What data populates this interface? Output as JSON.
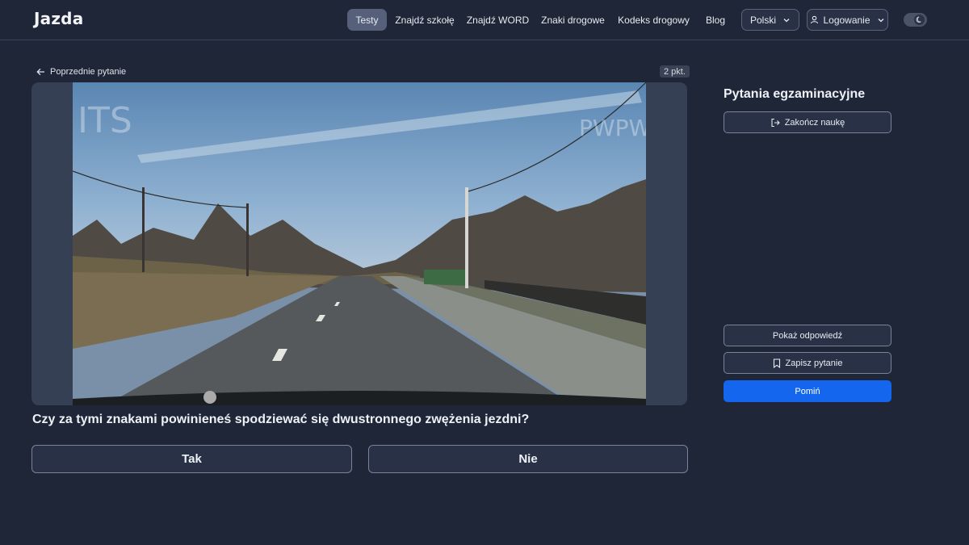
{
  "header": {
    "logo": "Jazda",
    "nav": [
      {
        "label": "Testy"
      },
      {
        "label": "Znajdź szkołę"
      },
      {
        "label": "Znajdź WORD"
      },
      {
        "label": "Znaki drogowe"
      },
      {
        "label": "Kodeks drogowy"
      },
      {
        "label": "Blog"
      }
    ],
    "language": "Polski",
    "login": "Logowanie"
  },
  "question": {
    "back_label": "Poprzednie pytanie",
    "points": "2 pkt.",
    "text": "Czy za tymi znakami powinieneś spodziewać się dwustronnego zwężenia jezdni?",
    "answers": [
      "Tak",
      "Nie"
    ],
    "video": {
      "watermark_left": "ITS",
      "watermark_right": "PWPW"
    }
  },
  "sidebar": {
    "title": "Pytania egzaminacyjne",
    "end_button": "Zakończ naukę",
    "show_answer": "Pokaż odpowiedź",
    "save_question": "Zapisz pytanie",
    "skip": "Pomiń"
  },
  "colors": {
    "background": "#1e2638",
    "accent": "#1466ef",
    "active_nav": "#56607a"
  }
}
